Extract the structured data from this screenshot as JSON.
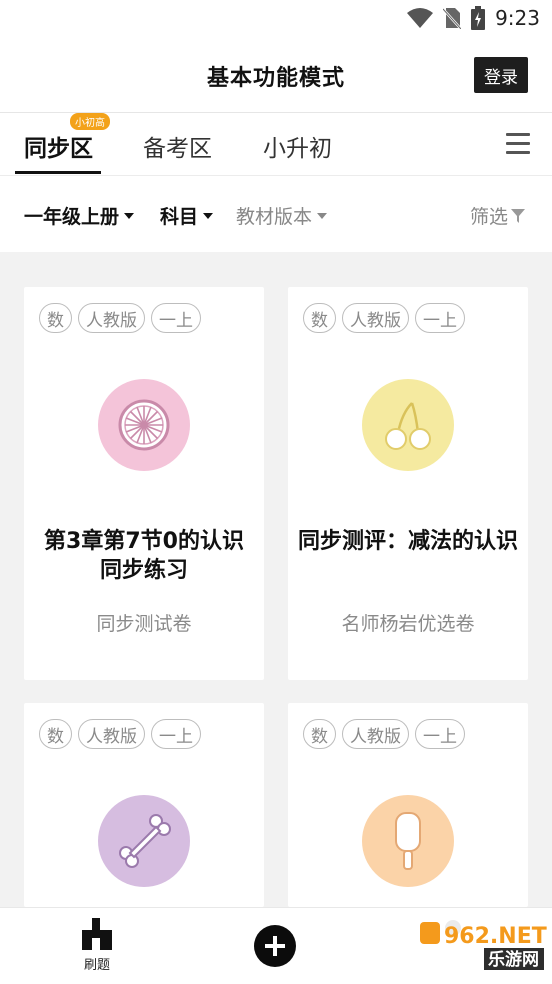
{
  "status_bar": {
    "time": "9:23",
    "icons": [
      "wifi-icon",
      "no-sim-icon",
      "battery-charging-icon"
    ]
  },
  "header": {
    "title": "基本功能模式",
    "login_label": "登录"
  },
  "tabs": [
    {
      "label": "同步区",
      "active": true,
      "badge": "小初高"
    },
    {
      "label": "备考区",
      "active": false
    },
    {
      "label": "小升初",
      "active": false
    }
  ],
  "filters": {
    "grade": "一年级上册",
    "subject": "科目",
    "edition": "教材版本",
    "filter_label": "筛选"
  },
  "cards": [
    {
      "tags": [
        "数",
        "人教版",
        "一上"
      ],
      "title": "第3章第7节0的认识同步练习",
      "subtitle": "同步测试卷",
      "icon": "citrus-slice-icon",
      "icon_color": "#f4c4d9"
    },
    {
      "tags": [
        "数",
        "人教版",
        "一上"
      ],
      "title": "同步测评：减法的认识",
      "subtitle": "名师杨岩优选卷",
      "icon": "cherries-icon",
      "icon_color": "#f5eaa0"
    },
    {
      "tags": [
        "数",
        "人教版",
        "一上"
      ],
      "title": "",
      "subtitle": "",
      "icon": "bone-icon",
      "icon_color": "#d6bde0"
    },
    {
      "tags": [
        "数",
        "人教版",
        "一上"
      ],
      "title": "",
      "subtitle": "",
      "icon": "popsicle-icon",
      "icon_color": "#fbd3a8"
    }
  ],
  "bottom_nav": {
    "practice_label": "刷题",
    "add_icon": "plus-circle-icon"
  },
  "watermark": {
    "text_top": "962.NET",
    "text_bottom": "乐游网"
  }
}
